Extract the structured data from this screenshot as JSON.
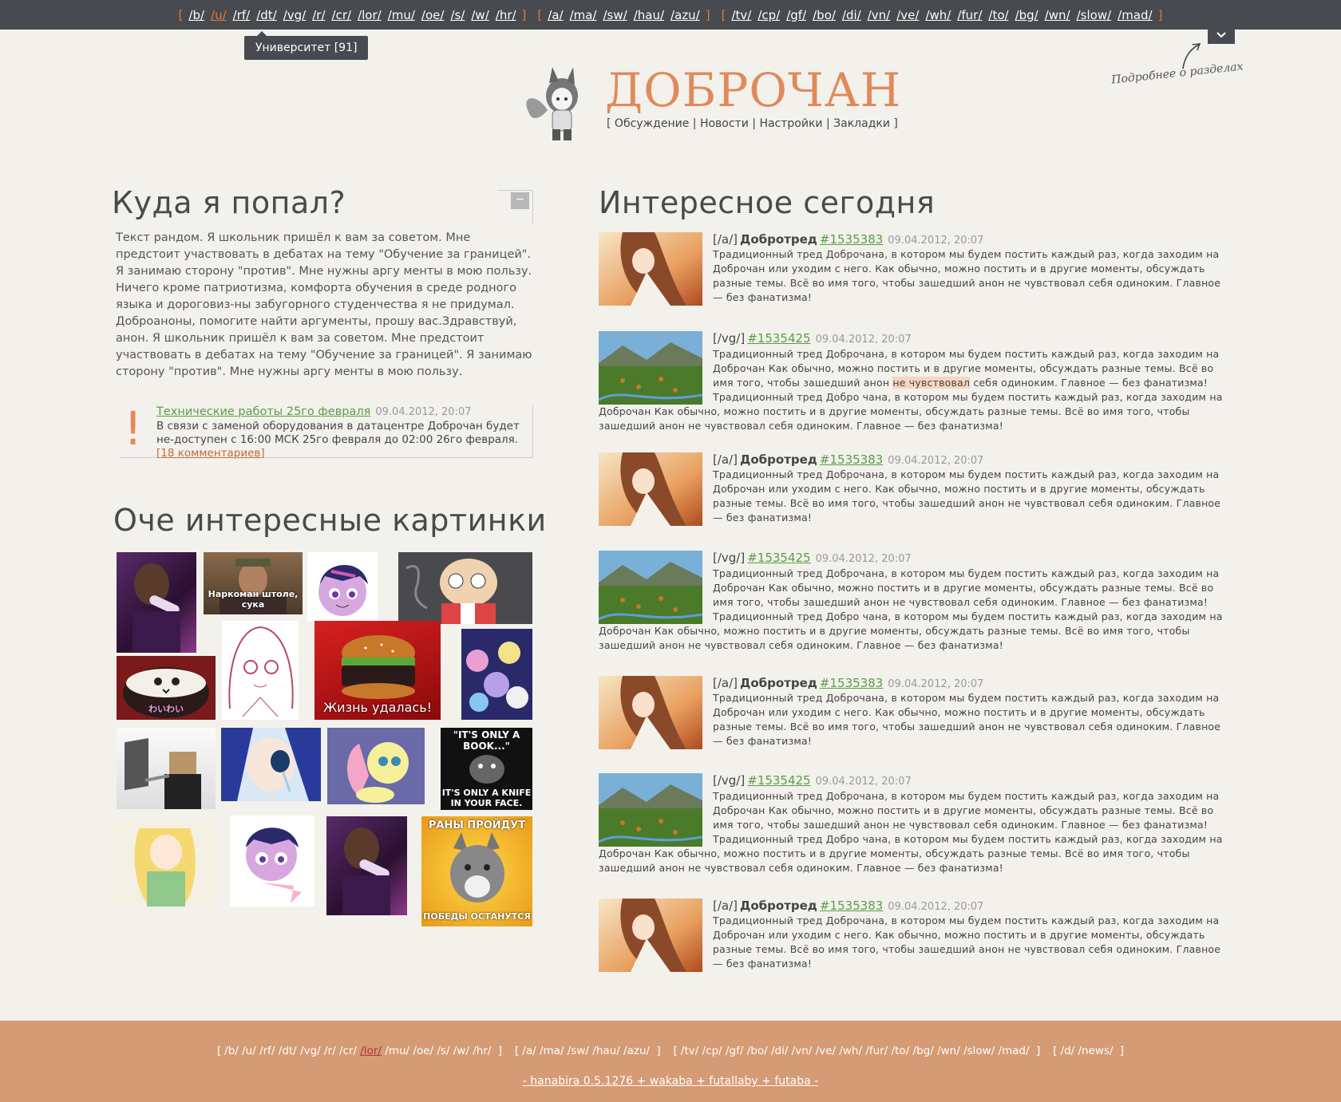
{
  "topnav": {
    "groups": [
      [
        "/b/",
        "/u/",
        "/rf/",
        "/dt/",
        "/vg/",
        "/r/",
        "/cr/",
        "/lor/",
        "/mu/",
        "/oe/",
        "/s/",
        "/w/",
        "/hr/"
      ],
      [
        "/a/",
        "/ma/",
        "/sw/",
        "/hau/",
        "/azu/"
      ],
      [
        "/tv/",
        "/cp/",
        "/gf/",
        "/bo/",
        "/di/",
        "/vn/",
        "/ve/",
        "/wh/",
        "/fur/",
        "/to/",
        "/bg/",
        "/wn/",
        "/slow/",
        "/mad/"
      ]
    ],
    "active": "/u/",
    "accent": "#e07a3c"
  },
  "tooltip": "Университет [91]",
  "collapse_icon": "chevron-down-icon",
  "more_hint": "Подробнее о разделах",
  "header": {
    "title": "ДОБРОЧАН",
    "links": [
      "Обсуждение",
      "Новости",
      "Настройки",
      "Закладки"
    ],
    "title_color": "#e08a5a"
  },
  "left": {
    "about_title": "Куда я попал?",
    "collapse_label": "−",
    "about_text": "Текст рандом. Я школьник пришёл к вам за советом. Мне предстоит участвовать в дебатах на тему \"Обучение за границей\". Я занимаю сторону \"против\". Мне нужны аргу менты в мою пользу. Ничего кроме патриотизма, комфорта обучения в среде родного языка и дороговиз-ны забугорного студенчества я не придумал.",
    "about_text2": "Доброаноны, помогите найти аргументы, прошу вас.Здравствуй, анон. Я школьник пришёл к вам за советом. Мне предстоит участвовать в дебатах на тему \"Обучение за границей\". Я занимаю сторону \"против\". Мне нужны аргу менты в мою пользу.",
    "notice": {
      "mark": "!",
      "title": "Технические работы 25го февраля",
      "date": "09.04.2012, 20:07",
      "text": "В связи с заменой оборудования в датацентре Доброчан будет не-доступен с 16:00 МСК 25го февраля до 02:00 26го февраля.",
      "link": "[18 комментариев]"
    },
    "gallery_title": "Оче интересные картинки",
    "gallery_captions": {
      "narkoman": "Наркоман штоле, сука",
      "burger": "Жизнь удалась!",
      "wolf1": "\"IT'S ONLY A BOOK...\"",
      "wolf1b": "IT'S ONLY A KNIFE IN YOUR FACE.",
      "wolf2": "РАНЫ ПРОЙДУТ",
      "wolf2b": "ПОБЕДЫ ОСТАНУТСЯ",
      "rice": "わいわい"
    }
  },
  "right": {
    "title": "Интересное сегодня",
    "posts": [
      {
        "board": "[/a/]",
        "title": "Добротред",
        "num": "#1535383",
        "date": "09.04.2012, 20:07",
        "body": "Традиционный тред Доброчана, в котором мы будем постить каждый раз, когда заходим на Доброчан или уходим с него. Как обычно, можно постить и в другие моменты, обсуждать разные темы. Всё во имя того, чтобы зашедший анон не чувствовал себя одиноким. Главное — без фанатизма!"
      },
      {
        "board": "[/vg/]",
        "title": "",
        "num": "#1535425",
        "date": "09.04.2012, 20:07",
        "body_a": "Традиционный тред Доброчана, в котором мы будем постить каждый раз, когда заходим на Доброчан Как обычно, можно постить и в другие моменты, обсуждать разные темы. Всё во имя того, чтобы зашедший анон ",
        "body_hl": "не чувствовал",
        "body_b": " себя одиноким. Главное — без фанатизма! Традиционный тред Добро чана, в котором мы будем постить каждый раз, когда заходим на Доброчан Как обычно, можно постить и в другие моменты, обсуждать разные темы. Всё во имя того, чтобы зашедший анон не чувствовал себя одиноким. Главное — без фанатизма!"
      },
      {
        "board": "[/a/]",
        "title": "Добротред",
        "num": "#1535383",
        "date": "09.04.2012, 20:07",
        "body": "Традиционный тред Доброчана, в котором мы будем постить каждый раз, когда заходим на Доброчан или уходим с него. Как обычно, можно постить и в другие моменты, обсуждать разные темы. Всё во имя того, чтобы зашедший анон не чувствовал себя одиноким. Главное — без фанатизма!"
      },
      {
        "board": "[/vg/]",
        "title": "",
        "num": "#1535425",
        "date": "09.04.2012, 20:07",
        "body": "Традиционный тред Доброчана, в котором мы будем постить каждый раз, когда заходим на Доброчан Как обычно, можно постить и в другие моменты, обсуждать разные темы. Всё во имя того, чтобы зашедший анон не чувствовал себя одиноким. Главное — без фанатизма! Традиционный тред Добро чана, в котором мы будем постить каждый раз, когда заходим на Доброчан Как обычно, можно постить и в другие моменты, обсуждать разные темы. Всё во имя того, чтобы зашедший анон не чувствовал себя одиноким. Главное — без фанатизма!"
      },
      {
        "board": "[/a/]",
        "title": "Добротред",
        "num": "#1535383",
        "date": "09.04.2012, 20:07",
        "body": "Традиционный тред Доброчана, в котором мы будем постить каждый раз, когда заходим на Доброчан или уходим с него. Как обычно, можно постить и в другие моменты, обсуждать разные темы. Всё во имя того, чтобы зашедший анон не чувствовал себя одиноким. Главное — без фанатизма!"
      },
      {
        "board": "[/vg/]",
        "title": "",
        "num": "#1535425",
        "date": "09.04.2012, 20:07",
        "body": "Традиционный тред Доброчана, в котором мы будем постить каждый раз, когда заходим на Доброчан Как обычно, можно постить и в другие моменты, обсуждать разные темы. Всё во имя того, чтобы зашедший анон не чувствовал себя одиноким. Главное — без фанатизма! Традиционный тред Добро чана, в котором мы будем постить каждый раз, когда заходим на Доброчан Как обычно, можно постить и в другие моменты, обсуждать разные темы. Всё во имя того, чтобы зашедший анон не чувствовал себя одиноким. Главное — без фанатизма!"
      },
      {
        "board": "[/a/]",
        "title": "Добротред",
        "num": "#1535383",
        "date": "09.04.2012, 20:07",
        "body": "Традиционный тред Доброчана, в котором мы будем постить каждый раз, когда заходим на Доброчан или уходим с него. Как обычно, можно постить и в другие моменты, обсуждать разные темы. Всё во имя того, чтобы зашедший анон не чувствовал себя одиноким. Главное — без фанатизма!"
      }
    ]
  },
  "footer": {
    "groups": [
      [
        "/b/",
        "/u/",
        "/rf/",
        "/dt/",
        "/vg/",
        "/r/",
        "/cr/",
        "/lor/",
        "/mu/",
        "/oe/",
        "/s/",
        "/w/",
        "/hr/"
      ],
      [
        "/a/",
        "/ma/",
        "/sw/",
        "/hau/",
        "/azu/"
      ],
      [
        "/tv/",
        "/cp/",
        "/gf/",
        "/bo/",
        "/di/",
        "/vn/",
        "/ve/",
        "/wh/",
        "/fur/",
        "/to/",
        "/bg/",
        "/wn/",
        "/slow/",
        "/mad/"
      ],
      [
        "/d/",
        "/news/"
      ]
    ],
    "active": "/lor/",
    "version": "- hanabira 0.5.1276 + wakaba + futallaby + futaba -",
    "bg": "#d59b75"
  }
}
